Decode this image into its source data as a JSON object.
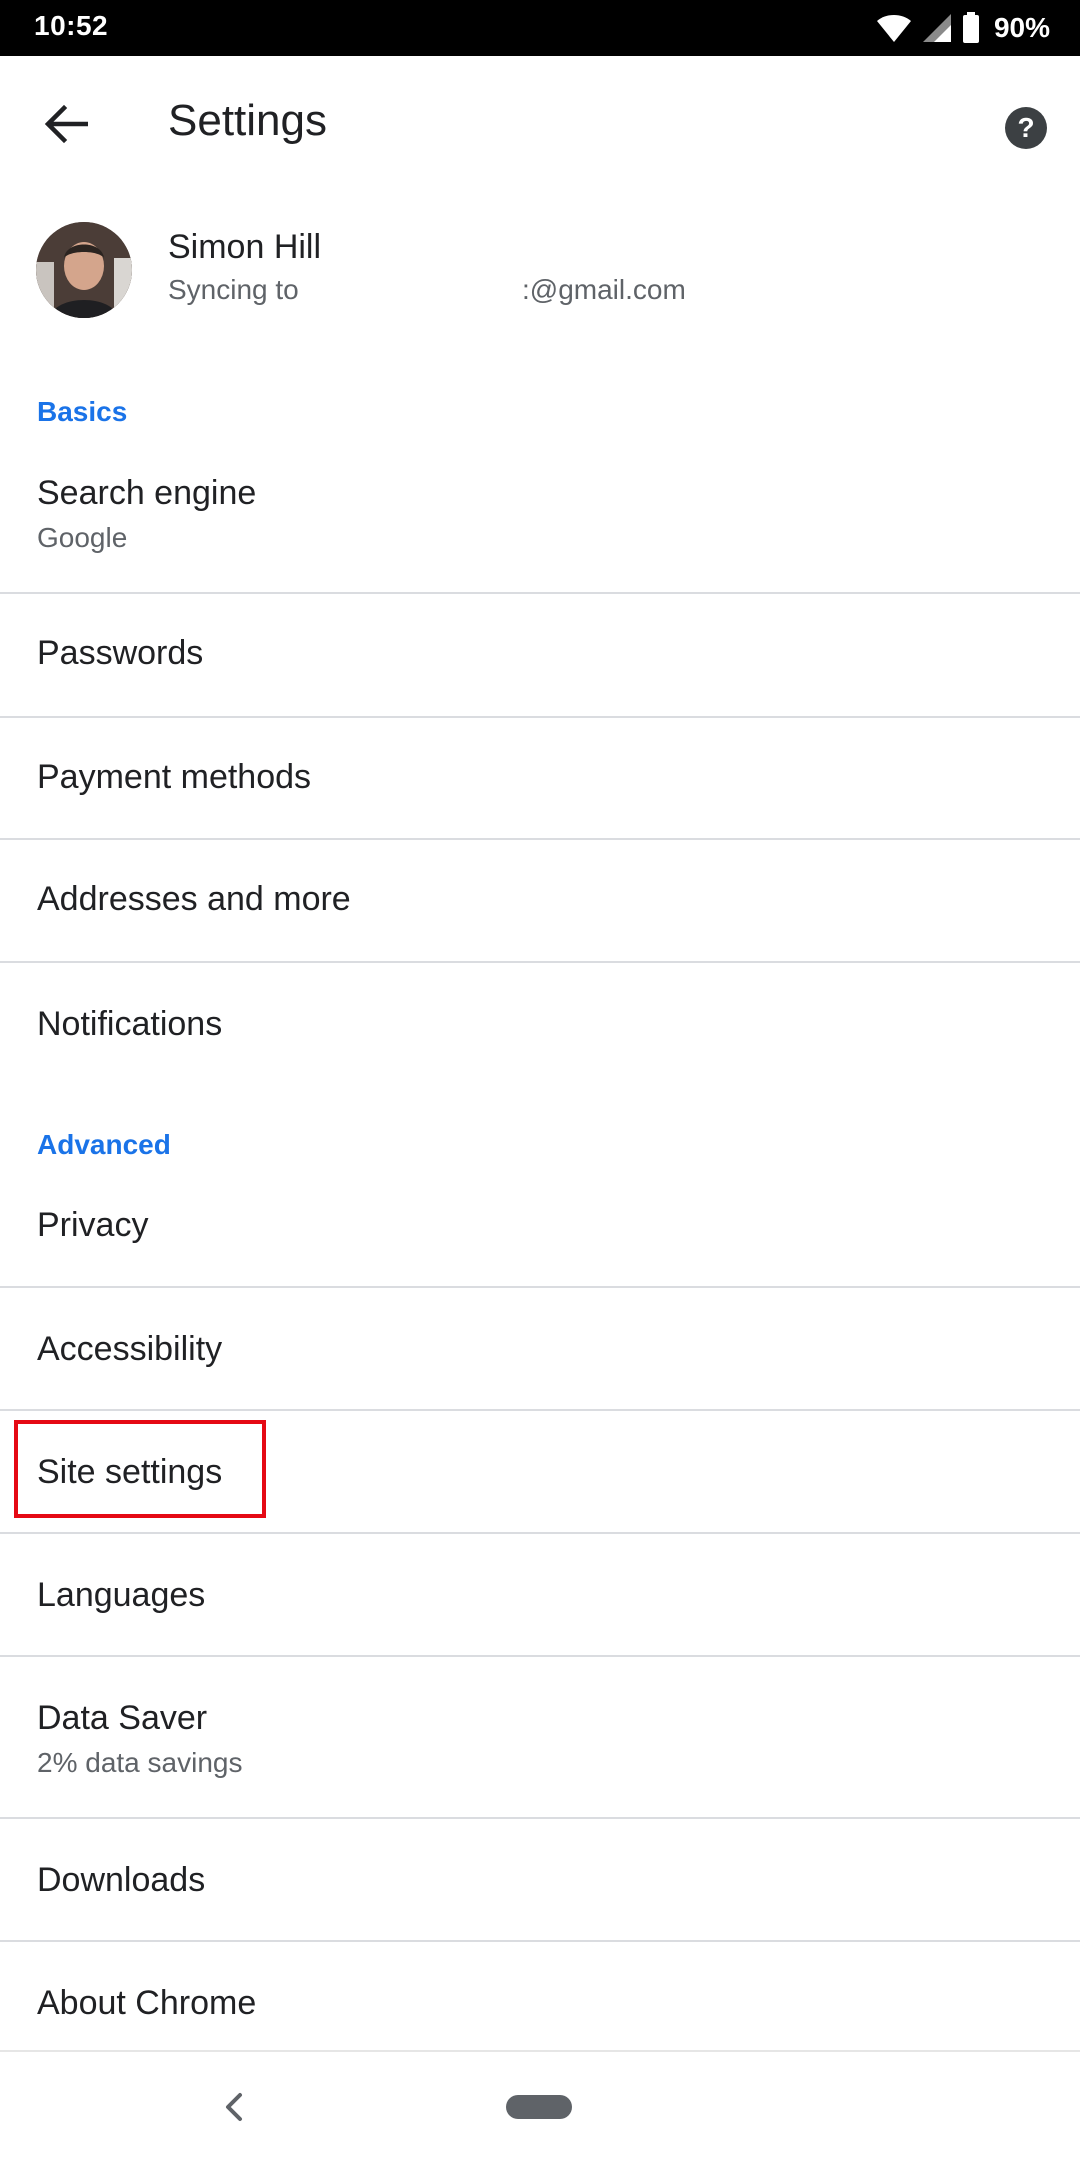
{
  "status_bar": {
    "time": "10:52",
    "battery": "90%",
    "icons": [
      "wifi-icon",
      "signal-icon",
      "battery-icon"
    ]
  },
  "app_bar": {
    "title": "Settings",
    "back_icon": "arrow-back-icon",
    "help_icon": "help-icon"
  },
  "account": {
    "name": "Simon Hill",
    "sync_prefix": "Syncing to",
    "email_visible": ":@gmail.com"
  },
  "sections": {
    "basics": "Basics",
    "advanced": "Advanced"
  },
  "items": {
    "search_engine": {
      "label": "Search engine",
      "value": "Google"
    },
    "passwords": {
      "label": "Passwords"
    },
    "payment_methods": {
      "label": "Payment methods"
    },
    "addresses": {
      "label": "Addresses and more"
    },
    "notifications": {
      "label": "Notifications"
    },
    "privacy": {
      "label": "Privacy"
    },
    "accessibility": {
      "label": "Accessibility"
    },
    "site_settings": {
      "label": "Site settings"
    },
    "languages": {
      "label": "Languages"
    },
    "data_saver": {
      "label": "Data Saver",
      "value": "2% data savings"
    },
    "downloads": {
      "label": "Downloads"
    },
    "about": {
      "label": "About Chrome"
    }
  },
  "colors": {
    "accent": "#1a73e8",
    "highlight": "#e50914",
    "text": "#202124",
    "secondary": "#5f6368"
  },
  "nav_bar": {
    "icons": [
      "nav-back-icon",
      "nav-home-pill"
    ]
  }
}
